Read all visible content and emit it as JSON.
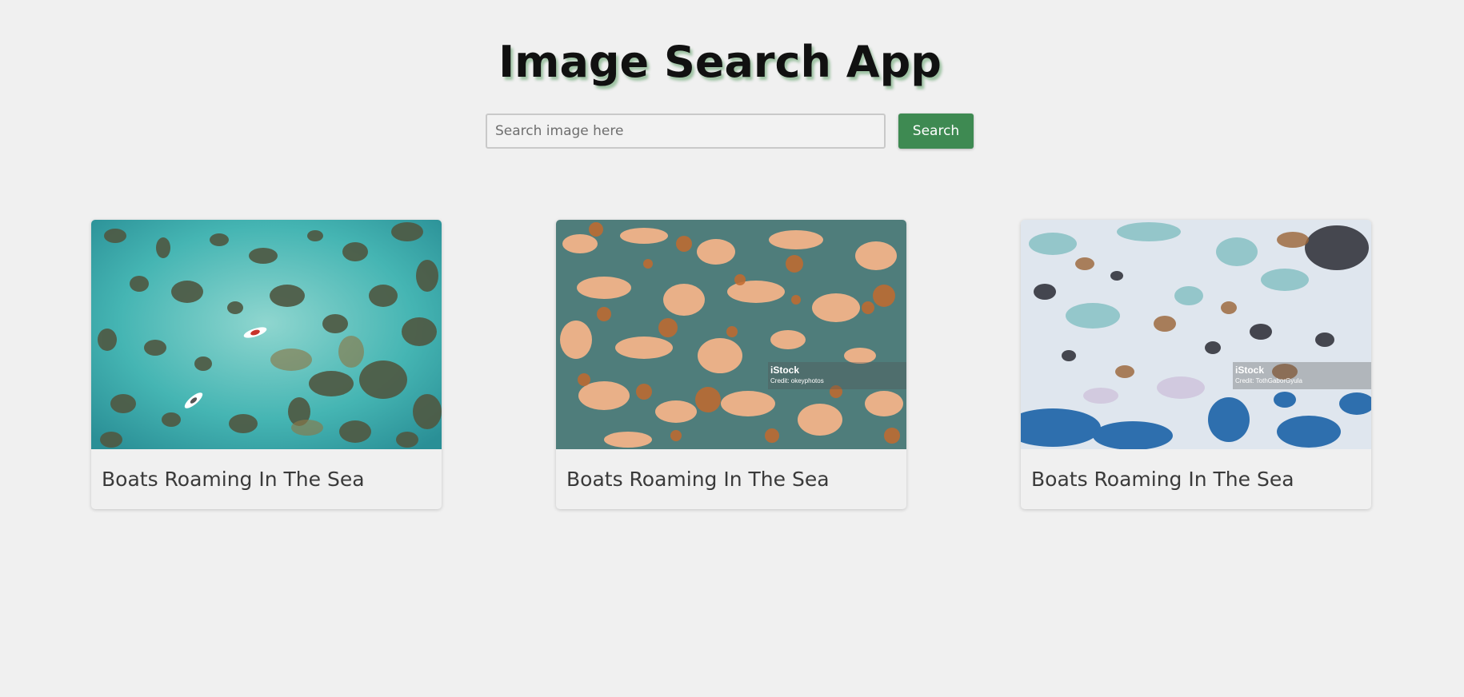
{
  "app": {
    "title": "Image Search App"
  },
  "search": {
    "placeholder": "Search image here",
    "value": "",
    "button_label": "Search"
  },
  "results": [
    {
      "caption": "Boats Roaming In The Sea",
      "image_subject": "aerial view of turquoise sea with reefs and two boats",
      "colors": {
        "base": "#3bb1b0",
        "accent": "#5b5a45"
      }
    },
    {
      "caption": "Boats Roaming In The Sea",
      "image_subject": "rusty teal painted metal texture",
      "colors": {
        "base": "#e8ae84",
        "accent": "#4d7a78"
      },
      "watermark": {
        "brand": "iStock",
        "credit": "Credit: okeyphotos"
      }
    },
    {
      "caption": "Boats Roaming In The Sea",
      "image_subject": "peeling blue white paint texture",
      "colors": {
        "base": "#dfe6ee",
        "accent": "#2e6fae"
      },
      "watermark": {
        "brand": "iStock",
        "credit": "Credit: TothGaborGyula"
      }
    }
  ]
}
